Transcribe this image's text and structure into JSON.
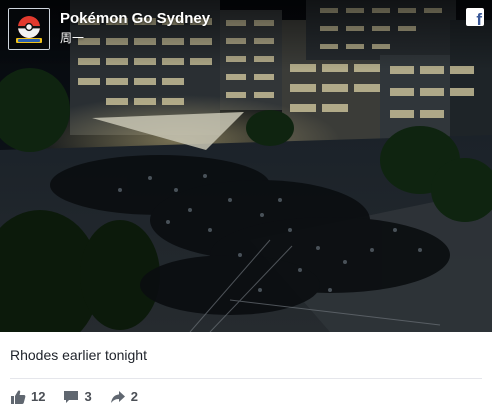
{
  "post": {
    "page_name": "Pokémon Go Sydney",
    "time": "周一",
    "caption": "Rhodes earlier tonight",
    "facebook_badge": "f",
    "reactions": {
      "likes": "12",
      "comments": "3",
      "shares": "2"
    },
    "icons": {
      "like": "thumbs-up-icon",
      "comment": "comment-bubble-icon",
      "share": "share-arrow-icon",
      "avatar": "pokeball-logo"
    },
    "colors": {
      "facebook_blue": "#3b5998",
      "action_grey": "#606770",
      "caption_text": "#1d2129"
    }
  }
}
